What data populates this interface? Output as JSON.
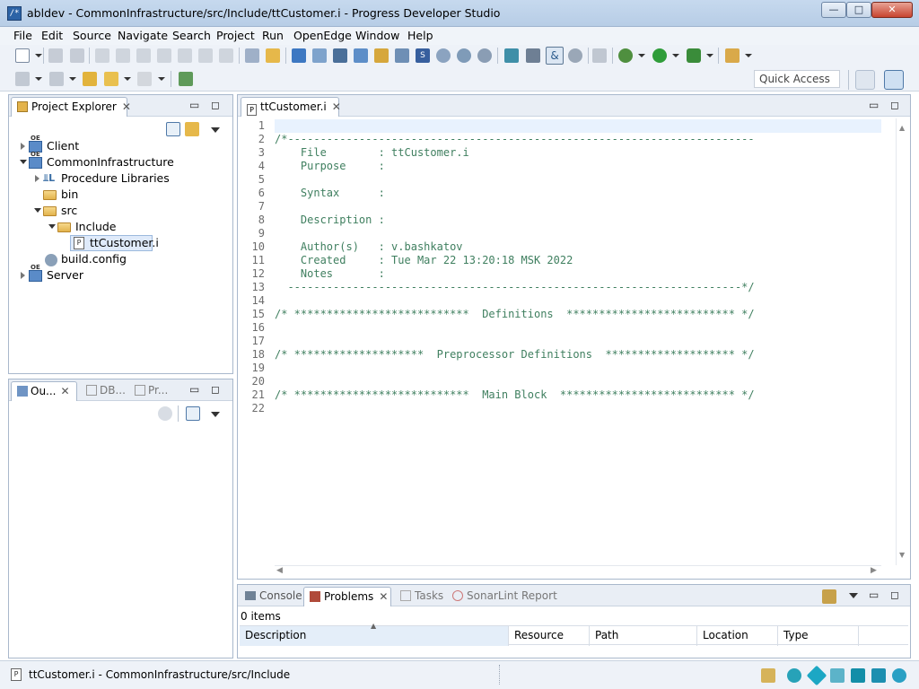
{
  "window": {
    "app_icon": "abl-icon",
    "title": "abldev - CommonInfrastructure/src/Include/ttCustomer.i - Progress Developer Studio",
    "min_label": "—",
    "max_label": "□",
    "close_label": "✕"
  },
  "menu": [
    "File",
    "Edit",
    "Source",
    "Navigate",
    "Search",
    "Project",
    "Run",
    "OpenEdge",
    "Window",
    "Help"
  ],
  "quick_access": {
    "placeholder": "Quick Access"
  },
  "project_explorer": {
    "tab_label": "Project Explorer",
    "items": [
      {
        "label": "Client"
      },
      {
        "label": "CommonInfrastructure"
      },
      {
        "label": "Procedure Libraries"
      },
      {
        "label": "bin"
      },
      {
        "label": "src"
      },
      {
        "label": "Include"
      },
      {
        "label": "ttCustomer.i"
      },
      {
        "label": "build.config"
      },
      {
        "label": "Server"
      }
    ]
  },
  "outline_panel": {
    "tabs": [
      {
        "label": "Ou..."
      },
      {
        "label": "DB..."
      },
      {
        "label": "Pr..."
      }
    ]
  },
  "editor": {
    "tab_label": "ttCustomer.i",
    "line_numbers": [
      "1",
      "2",
      "3",
      "4",
      "5",
      "6",
      "7",
      "8",
      "9",
      "10",
      "11",
      "12",
      "13",
      "14",
      "15",
      "16",
      "17",
      "18",
      "19",
      "20",
      "21",
      "22"
    ],
    "lines": [
      "",
      "/*------------------------------------------------------------------------",
      "    File        : ttCustomer.i",
      "    Purpose     :",
      "",
      "    Syntax      :",
      "",
      "    Description :",
      "",
      "    Author(s)   : v.bashkatov",
      "    Created     : Tue Mar 22 13:20:18 MSK 2022",
      "    Notes       :",
      "  ----------------------------------------------------------------------*/",
      "",
      "/* ***************************  Definitions  ************************** */",
      "",
      "",
      "/* ********************  Preprocessor Definitions  ******************** */",
      "",
      "",
      "/* ***************************  Main Block  *************************** */",
      ""
    ]
  },
  "bottom_panel": {
    "tabs": [
      {
        "label": "Console"
      },
      {
        "label": "Problems"
      },
      {
        "label": "Tasks"
      },
      {
        "label": "SonarLint Report"
      }
    ],
    "items_count": "0 items",
    "columns": [
      "Description",
      "Resource",
      "Path",
      "Location",
      "Type"
    ]
  },
  "status": {
    "path": "ttCustomer.i - CommonInfrastructure/src/Include"
  },
  "colors": {
    "accent": "#3c7fb1",
    "comment": "#3f7f5f",
    "current_line": "#e8f2fe"
  }
}
